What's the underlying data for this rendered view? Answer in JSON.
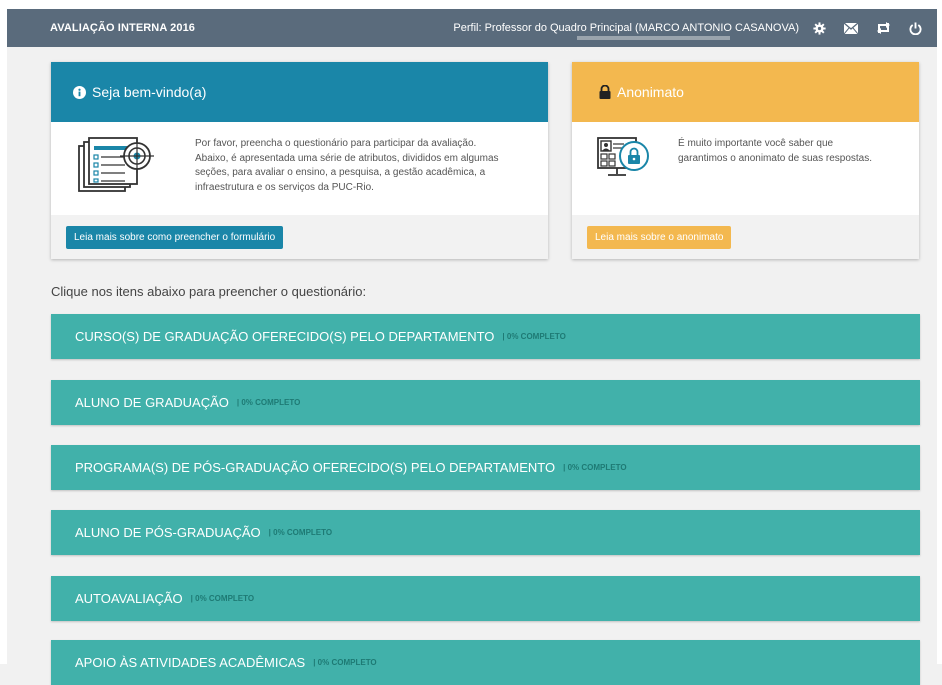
{
  "header": {
    "app_title": "AVALIAÇÃO INTERNA 2016",
    "profile_text": "Perfil: Professor do Quadro Principal (MARCO ANTONIO CASANOVA)",
    "icons": [
      "gear-icon",
      "mail-icon",
      "switch-icon",
      "power-icon"
    ]
  },
  "welcome_card": {
    "title": "Seja bem-vindo(a)",
    "lines": [
      "Por favor, preencha o questionário para participar da avaliação.",
      "Abaixo, é apresentada uma série de atributos, divididos em algumas",
      "seções, para avaliar o ensino, a pesquisa, a gestão acadêmica, a",
      "infraestrutura e os serviços da PUC-Rio."
    ],
    "button": "Leia mais sobre como preencher o formulário",
    "color": "#1a86a8"
  },
  "anon_card": {
    "title": "Anonimato",
    "lines": [
      "É muito importante você saber que",
      "garantimos o anonimato de suas respostas."
    ],
    "button": "Leia mais sobre o anonimato",
    "color": "#f3b84f"
  },
  "instructions": "Clique nos itens abaixo para preencher o questionário:",
  "sections": [
    {
      "name": "CURSO(S) DE GRADUAÇÃO OFERECIDO(S) PELO DEPARTAMENTO",
      "progress": "| 0% COMPLETO"
    },
    {
      "name": "ALUNO DE GRADUAÇÃO",
      "progress": "| 0% COMPLETO"
    },
    {
      "name": "PROGRAMA(S) DE PÓS-GRADUAÇÃO OFERECIDO(S) PELO DEPARTAMENTO",
      "progress": "| 0% COMPLETO"
    },
    {
      "name": "ALUNO DE PÓS-GRADUAÇÃO",
      "progress": "| 0% COMPLETO"
    },
    {
      "name": "AUTOAVALIAÇÃO",
      "progress": "| 0% COMPLETO"
    },
    {
      "name": "APOIO ÀS ATIVIDADES ACADÊMICAS",
      "progress": "| 0% COMPLETO"
    }
  ],
  "colors": {
    "section": "#41b1aa",
    "topbar": "#5a6b7c"
  }
}
